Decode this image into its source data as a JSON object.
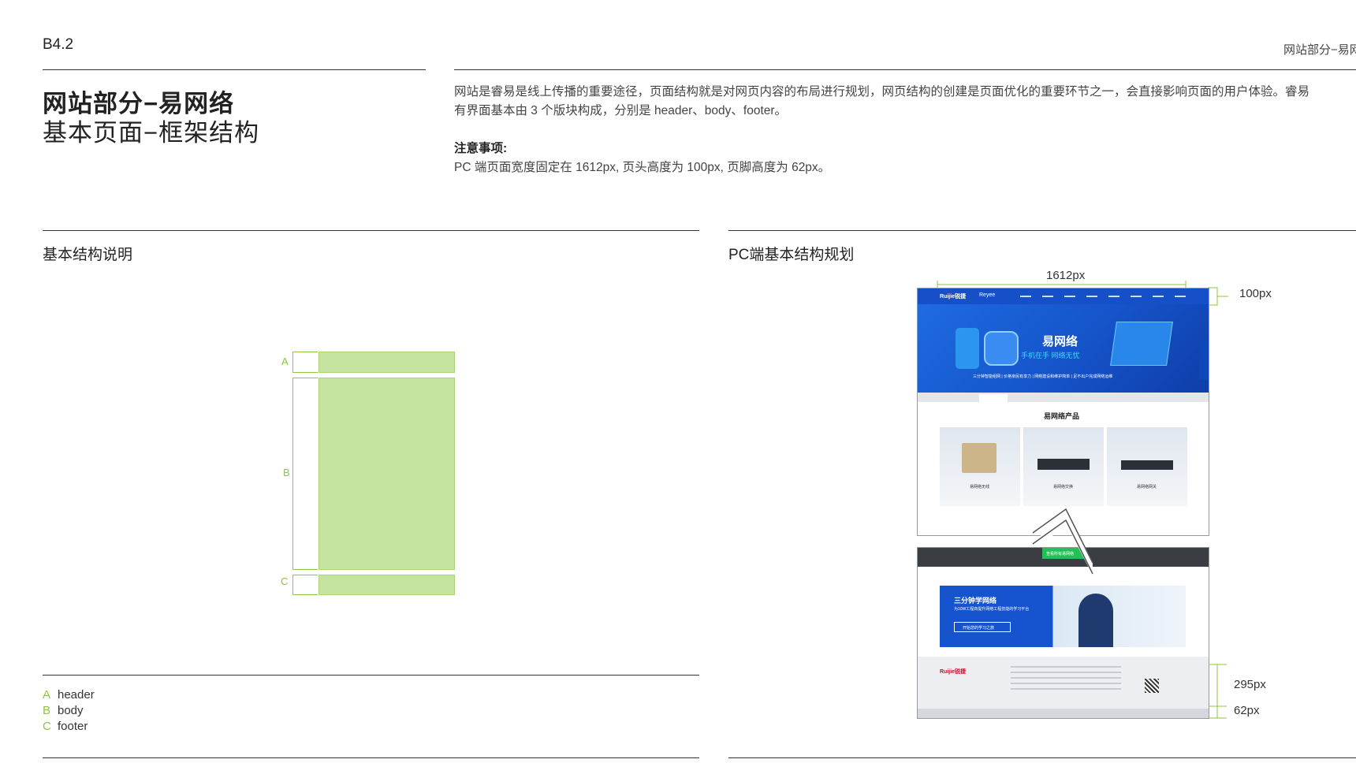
{
  "header": {
    "code": "B4.2",
    "section": "网站部分−易网络"
  },
  "title": {
    "line1": "网站部分−易网络",
    "line2": "基本页面−框架结构"
  },
  "intro": {
    "line1": "网站是睿易是线上传播的重要途径，页面结构就是对网页内容的布局进行规划，网页结构的创建是页面优化的重要环节之一，会直接影响页面的用户体验。睿易",
    "line2": "有界面基本由 3 个版块构成，分别是 header、body、footer。",
    "note_label": "注意事项:",
    "note_text": "PC 端页面宽度固定在 1612px, 页头高度为 100px, 页脚高度为 62px。"
  },
  "left_section": {
    "title": "基本结构说明",
    "labels": [
      "A",
      "B",
      "C"
    ],
    "legend": [
      {
        "key": "A",
        "text": "header"
      },
      {
        "key": "B",
        "text": "body"
      },
      {
        "key": "C",
        "text": "footer"
      }
    ]
  },
  "right_section": {
    "title": "PC端基本结构规划",
    "width_label": "1612px",
    "header_height_label": "100px",
    "footer_block_label": "295px",
    "footer_height_label": "62px"
  },
  "mock": {
    "brand": "Ruijie锐捷",
    "brand2": "Reyee",
    "hero_title": "易网络",
    "hero_sub": "手机在手 网络无忧",
    "hero_features": "三分钟智能组网  |  价格亲民有享力  |  网络建设和维护简单  |  足不出户完成网络运维",
    "product_title": "易网络产品",
    "product_names": [
      "易网络无线",
      "易网络交换",
      "易网络网关"
    ],
    "cta_button": "查看所有易网络",
    "course_title": "三分钟学网络",
    "course_sub": "为10W工程商提升网络工程技能的学习平台",
    "course_button": "开始您的学习之旅"
  },
  "colors": {
    "accent_green": "#8cc63f",
    "box_green": "#c6e4a0",
    "hero_blue": "#1a5fd6",
    "brand_red": "#c8102e"
  }
}
